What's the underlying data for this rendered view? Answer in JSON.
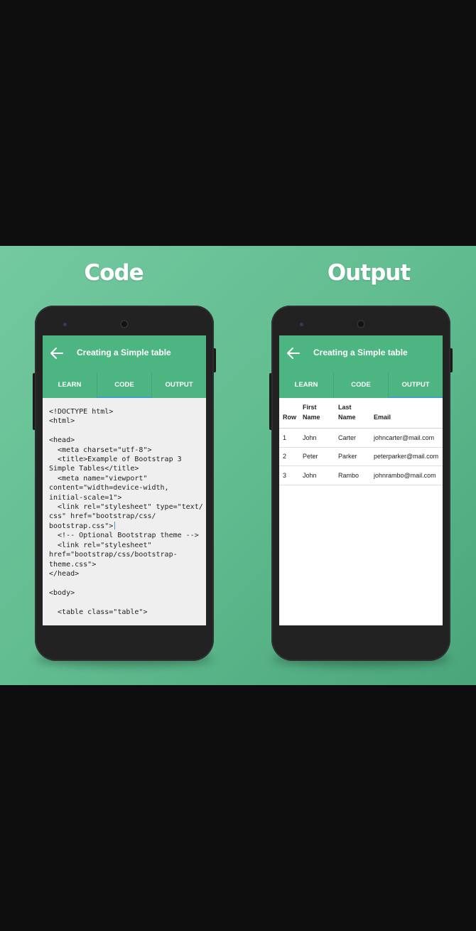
{
  "headings": {
    "code": "Code",
    "output": "Output"
  },
  "app": {
    "title": "Creating a Simple table",
    "tabs": [
      "LEARN",
      "CODE",
      "OUTPUT"
    ]
  },
  "code_lines": [
    "<!DOCTYPE html>",
    "<html>",
    "",
    "<head>",
    "  <meta charset=\"utf-8\">",
    "  <title>Example of Bootstrap 3",
    "Simple Tables</title>",
    "  <meta name=\"viewport\"",
    "content=\"width=device-width,",
    "initial-scale=1\">",
    "  <link rel=\"stylesheet\" type=\"text/",
    "css\" href=\"bootstrap/css/",
    "bootstrap.css\">",
    "  <!-- Optional Bootstrap theme -->",
    "  <link rel=\"stylesheet\"",
    "href=\"bootstrap/css/bootstrap-",
    "theme.css\">",
    "</head>",
    "",
    "<body>",
    "",
    "  <table class=\"table\">"
  ],
  "output_table": {
    "headers": [
      "Row",
      "First\nName",
      "Last\nName",
      "Email"
    ],
    "rows": [
      [
        "1",
        "John",
        "Carter",
        "johncarter@mail.com"
      ],
      [
        "2",
        "Peter",
        "Parker",
        "peterparker@mail.com"
      ],
      [
        "3",
        "John",
        "Rambo",
        "johnrambo@mail.com"
      ]
    ]
  },
  "colors": {
    "accent": "#4db582",
    "tab_indicator": "#3e9fc7",
    "background": "#5fbb8e"
  }
}
